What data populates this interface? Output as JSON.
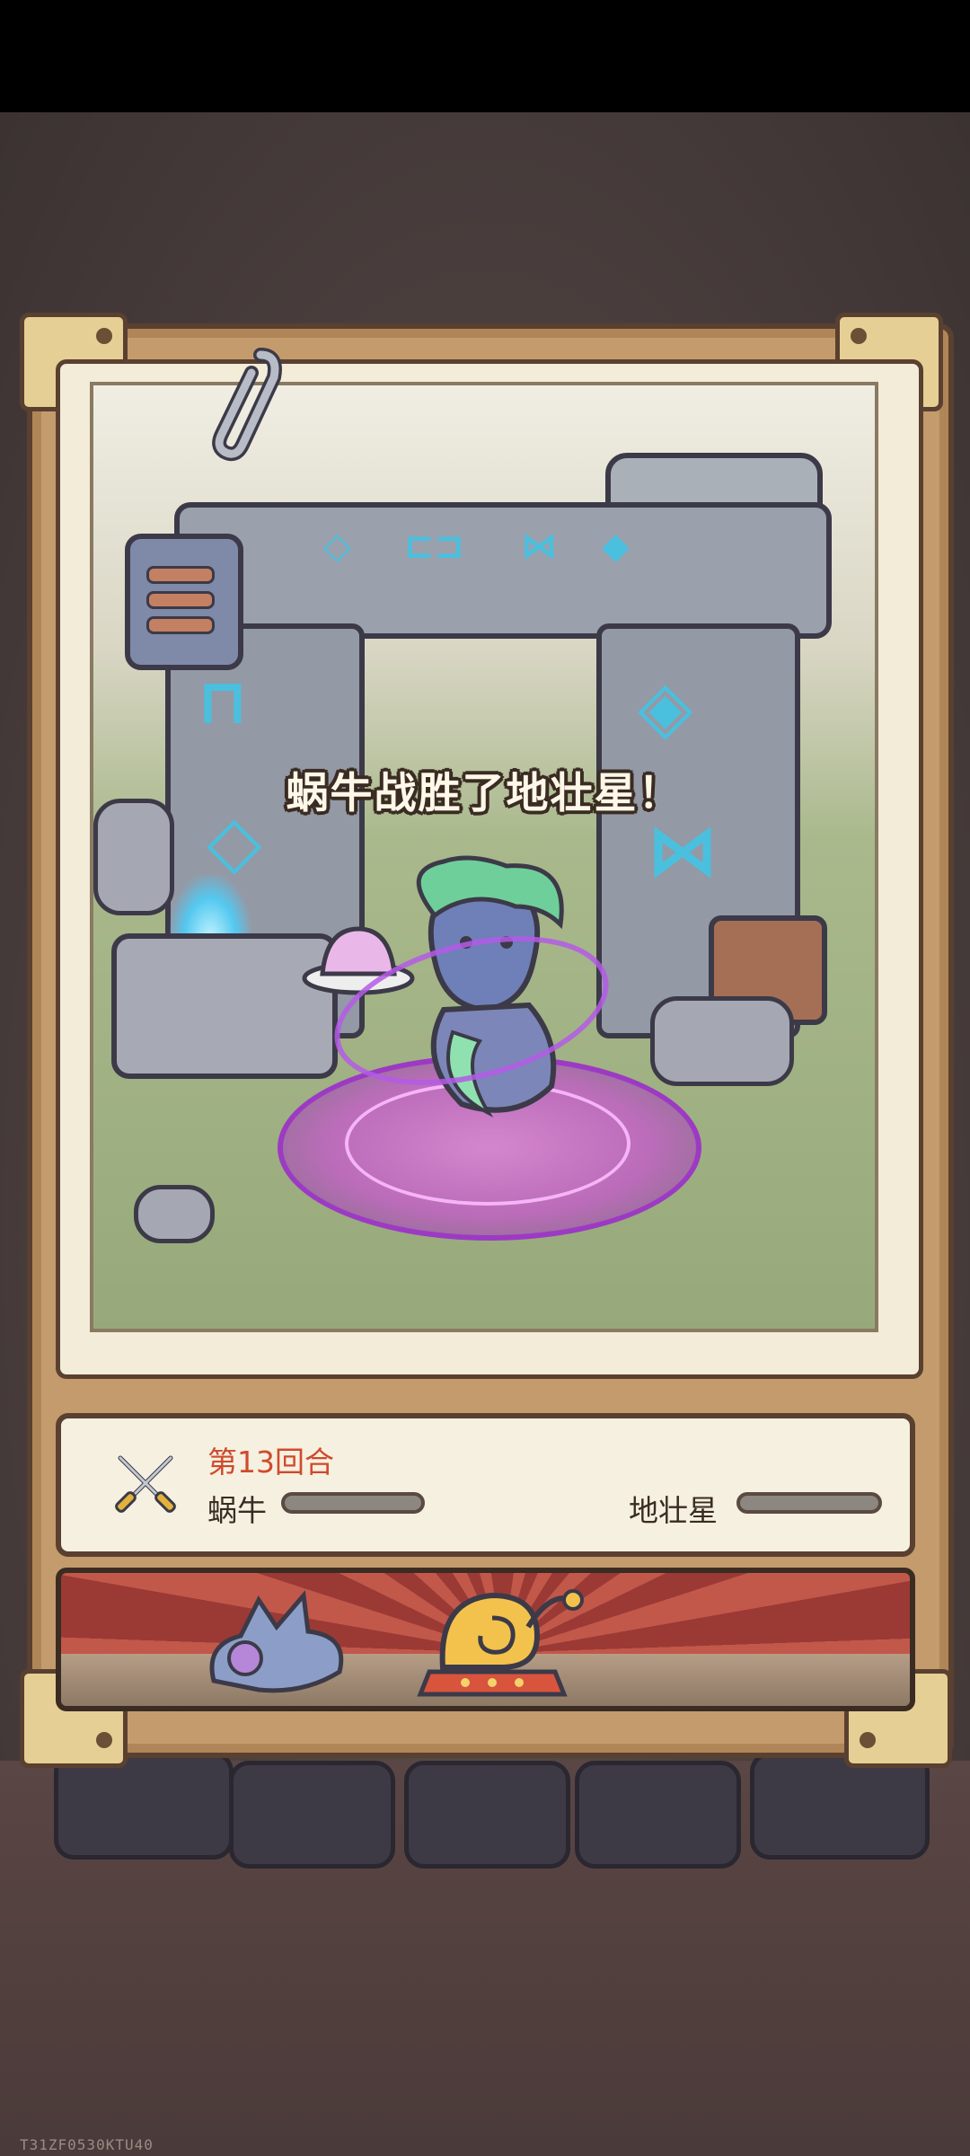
{
  "scene": {
    "victory_message": "蜗牛战胜了地壮星！"
  },
  "round_panel": {
    "round_label": "第13回合",
    "player_name": "蜗牛",
    "opponent_name": "地壮星",
    "icon": "crossed-swords-icon"
  },
  "footer": {
    "watermark": "T31ZF0530KTU40"
  },
  "colors": {
    "round_label": "#d04a2c",
    "frame": "#c49b6c",
    "panel": "#f5f0e0"
  }
}
